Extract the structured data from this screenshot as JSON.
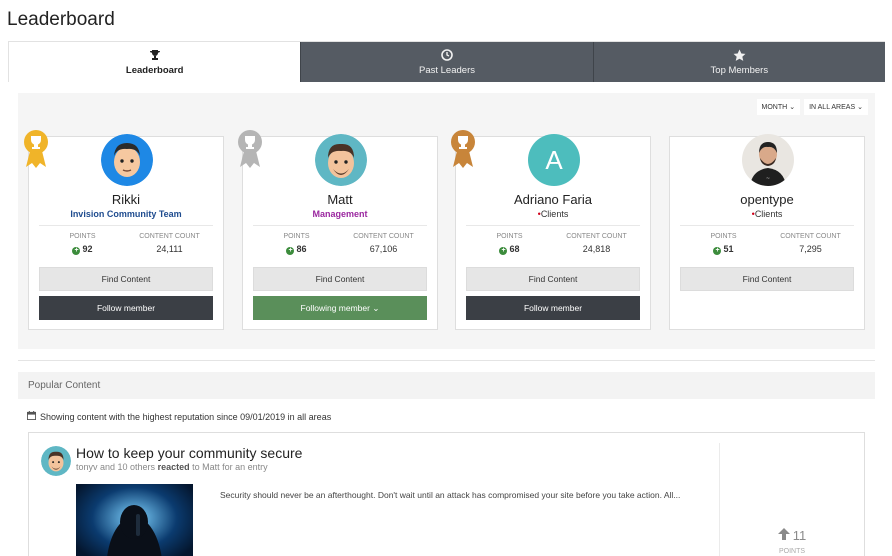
{
  "page": {
    "title": "Leaderboard"
  },
  "tabs": [
    {
      "label": "Leaderboard",
      "icon": "trophy-icon",
      "active": true
    },
    {
      "label": "Past Leaders",
      "icon": "clock-icon",
      "active": false
    },
    {
      "label": "Top Members",
      "icon": "star-icon",
      "active": false
    }
  ],
  "filters": {
    "period": "MONTH",
    "area": "IN ALL AREAS"
  },
  "leaders": [
    {
      "rank": "gold",
      "name": "Rikki",
      "group": "Invision Community Team",
      "group_color": "#1f4c8f",
      "points_label": "POINTS",
      "points": "92",
      "content_label": "CONTENT COUNT",
      "content": "24,111",
      "find": "Find Content",
      "follow": "Follow member"
    },
    {
      "rank": "silver",
      "name": "Matt",
      "group": "Management",
      "group_color": "#9b27a0",
      "points_label": "POINTS",
      "points": "86",
      "content_label": "CONTENT COUNT",
      "content": "67,106",
      "find": "Find Content",
      "follow": "Following member"
    },
    {
      "rank": "bronze",
      "name": "Adriano Faria",
      "group": "Clients",
      "group_color": "#333333",
      "points_label": "POINTS",
      "points": "68",
      "content_label": "CONTENT COUNT",
      "content": "24,818",
      "find": "Find Content",
      "follow": "Follow member",
      "initial": "A"
    },
    {
      "rank": "none",
      "name": "opentype",
      "group": "Clients",
      "group_color": "#333333",
      "points_label": "POINTS",
      "points": "51",
      "content_label": "CONTENT COUNT",
      "content": "7,295",
      "find": "Find Content"
    }
  ],
  "popular": {
    "heading": "Popular Content",
    "info": "Showing content with the highest reputation since 09/01/2019 in all areas",
    "entry": {
      "title": "How to keep your community secure",
      "meta_prefix": "tonyv and 10 others",
      "meta_action": "reacted",
      "meta_suffix": "to Matt for an entry",
      "excerpt": "Security should never be an afterthought. Don't wait until an attack has compromised your site before you take action. All...",
      "points": "11",
      "points_label": "POINTS"
    }
  },
  "colors": {
    "tab_dark": "#555b63",
    "follow": "#3b3f45",
    "following": "#5a8f5a",
    "gold": "#f0b429",
    "silver": "#b5b5b5",
    "bronze": "#c8853a"
  }
}
